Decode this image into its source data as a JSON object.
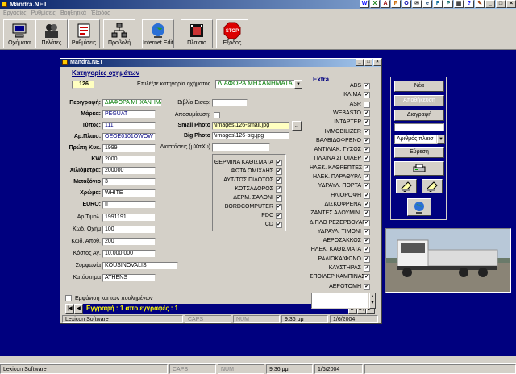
{
  "window": {
    "title": "Mandra.NET"
  },
  "menu": [
    "Εργασίες",
    "Ρυθμίσεις",
    "Βοηθητικά",
    "Έξοδος"
  ],
  "toolbar": [
    {
      "label": "Οχήματα",
      "icon": "computer-icon"
    },
    {
      "label": "Πελάτες",
      "icon": "people-icon"
    },
    {
      "label": "Ρυθμίσεις",
      "icon": "settings-icon"
    },
    {
      "label": "Προβολή",
      "icon": "network-icon"
    },
    {
      "label": "Internet Edit",
      "icon": "globe-icon"
    },
    {
      "label": "Πλαίσιο",
      "icon": "film-icon"
    },
    {
      "label": "Εξοδος",
      "icon": "stop-icon"
    }
  ],
  "inner": {
    "title": "Mandra.NET",
    "category_title": "Κατηγορίες οχημάτων",
    "category_code": "126",
    "category_prompt": "Επιλέξτε κατηγορία οχήματος",
    "category_value": "ΔΙΑΦΟΡΑ ΜΗΧΑΝΗΜΑΤΑ",
    "fields": [
      {
        "label": "Περιγραφή:",
        "value": "ΔΙΑΦΟΡΑ ΜΗΧΑΝΗΜΑΤΑ"
      },
      {
        "label": "Μάρκα:",
        "value": "PEGUAT"
      },
      {
        "label": "Τύπος:",
        "value": "111"
      },
      {
        "label": "Αρ.Πλαισ.",
        "value": "OEOE0101OWOW"
      },
      {
        "label": "Πρώτη Κυκ.",
        "value": "1999"
      },
      {
        "label": "KW",
        "value": "2000"
      },
      {
        "label": "Χιλιόμετρα:",
        "value": "200000"
      },
      {
        "label": "Μεταξόνιο",
        "value": "3"
      },
      {
        "label": "Χρώμα:",
        "value": "WHITE"
      },
      {
        "label": "EURO:",
        "value": "II"
      },
      {
        "label": "Αρ Τιμολ.",
        "value": "1991191"
      },
      {
        "label": "Κωδ. Οχήμ",
        "value": "100"
      },
      {
        "label": "Κωδ. Αποθ.",
        "value": "200"
      },
      {
        "label": "Κόστος Αγ.",
        "value": "10.000.000"
      },
      {
        "label": "Συμφωνία",
        "value": "KOUSINOVALIS"
      },
      {
        "label": "Κατάστημα",
        "value": "ATHENS"
      }
    ],
    "book_label": "Βιβλίο Εισερ:",
    "book_value": "",
    "posted_label": "Αποσυμίευση:",
    "small_photo_label": "Small Photo",
    "small_photo_value": "\\images\\126-small.jpg",
    "big_photo_label": "Big Photo",
    "big_photo_value": "\\images\\126-big.jpg",
    "dimensions_label": "Διαστάσεις (μΧπΧυ)",
    "dimensions_value": "",
    "browse_label": "...",
    "features": [
      {
        "label": "ΘΕΡΜΙΝΑ ΚΑΘΙΣΜΑΤΑ",
        "checked": true
      },
      {
        "label": "ΦΩΤΑ ΟΜΙΧΛΗΣ",
        "checked": true
      },
      {
        "label": "ΑΥΤ/ΤΟΣ ΠΙΛΟΤΟΣ",
        "checked": true
      },
      {
        "label": "ΚΟΤΣΑΔΟΡΟΣ",
        "checked": true
      },
      {
        "label": "ΔΕΡΜ. ΣΑΛΟΝΙ",
        "checked": true
      },
      {
        "label": "BORDCOMPUTER",
        "checked": true
      },
      {
        "label": "PDC",
        "checked": true
      },
      {
        "label": "CD",
        "checked": true
      }
    ],
    "show_sold_label": "Εμφάνιση και των πουλημένων",
    "record_text": "Εγγραφή : 1 απο εγγραφές : 1",
    "status": [
      "Lexicon Software",
      "CAPS",
      "NUM",
      "9:36 μμ",
      "1/6/2004"
    ]
  },
  "extra": {
    "title": "Extra",
    "items": [
      {
        "label": "ABS",
        "checked": true
      },
      {
        "label": "ΚΛΙΜΑ",
        "checked": true
      },
      {
        "label": "ASR",
        "checked": false
      },
      {
        "label": "WEBASTO",
        "checked": true
      },
      {
        "label": "INTAPTEP",
        "checked": true
      },
      {
        "label": "IMMOBILIZER",
        "checked": true
      },
      {
        "label": "ΒΑΛΒΙΔΟΦΡΕΝΟ",
        "checked": true
      },
      {
        "label": "ΑΝΤΙΛΙΑΚ. ΓΥΣΟΣ",
        "checked": true
      },
      {
        "label": "ΠΛΑΙΝΑ ΣΠΟΙΛΕΡ",
        "checked": true
      },
      {
        "label": "ΗΛΕΚ. ΚΑΘΡΕΠΤΕΣ",
        "checked": true
      },
      {
        "label": "ΗΛΕΚ. ΠΑΡΑΘΥΡΑ",
        "checked": true
      },
      {
        "label": "ΥΔΡΑΥΛ. ΠΟΡΤΑ",
        "checked": true
      },
      {
        "label": "ΗΛΙΟΡΟΦΗ",
        "checked": true
      },
      {
        "label": "ΔΙΣΚΟΦΡΕΝΑ",
        "checked": true
      },
      {
        "label": "ΖΑΝΤΕΣ ΑΛΟΥΜΙΝ.",
        "checked": true
      },
      {
        "label": "ΔΙΠΛΟ ΡΕΖΕΡΒΟΥΑΡ",
        "checked": true
      },
      {
        "label": "ΥΔΡΑΥΛ. ΤΙΜΟΝΙ",
        "checked": true
      },
      {
        "label": "ΑΕΡΟΣΑΚΚΟΣ",
        "checked": true
      },
      {
        "label": "ΗΛΕΚ. ΚΑΘΙΣΜΑΤΑ",
        "checked": true
      },
      {
        "label": "ΡΑΔΙΟΚΑ/ΦΩΝΟ",
        "checked": true
      },
      {
        "label": "ΚΑΥΣΤΗΡΑΣ",
        "checked": true
      },
      {
        "label": "ΣΠΟΙΛΕΡ ΚΑΜΠΙΝΑΣ",
        "checked": true
      },
      {
        "label": "ΑΕΡΟΤΟΜΗ",
        "checked": true
      }
    ]
  },
  "actions": {
    "new_label": "Νέα",
    "save_label": "Αποθήκευση",
    "delete_label": "Διαγραφή",
    "search_value": "",
    "search_by_value": "Αριθμός πλαισ",
    "find_label": "Εύρεση"
  },
  "colors": {
    "desktop": "#00007f",
    "title_start": "#0a246a",
    "title_end": "#a6caf0",
    "record_text": "#ffff00"
  },
  "status": [
    "Lexicon Software",
    "CAPS",
    "NUM",
    "9:36 μμ",
    "1/6/2004"
  ]
}
